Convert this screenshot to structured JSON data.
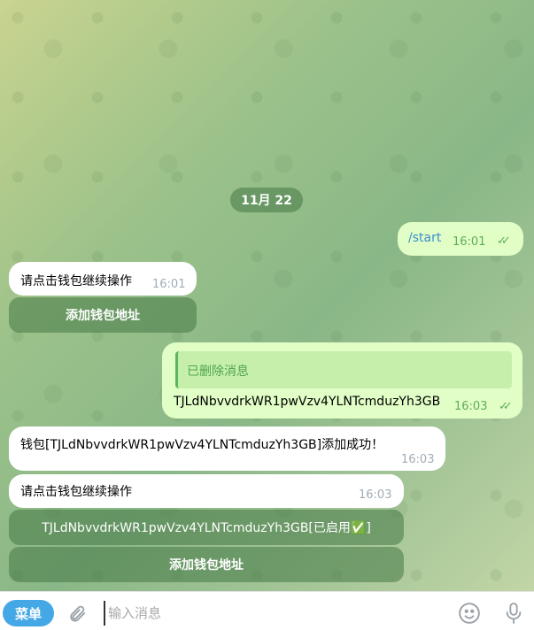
{
  "date_separator": "11月 22",
  "messages": {
    "start": {
      "text": "/start",
      "time": "16:01",
      "status": "✓✓"
    },
    "prompt1": {
      "text": "请点击钱包继续操作",
      "time": "16:01",
      "button": "添加钱包地址"
    },
    "wallet_out": {
      "quote_label": "已删除消息",
      "text": "TJLdNbvvdrkWR1pwVzv4YLNTcmduzYh3GB",
      "time": "16:03",
      "status": "✓✓"
    },
    "added": {
      "text": "钱包[TJLdNbvvdrkWR1pwVzv4YLNTcmduzYh3GB]添加成功！",
      "time": "16:03"
    },
    "prompt2": {
      "text": "请点击钱包继续操作",
      "time": "16:03",
      "wallet_button": "TJLdNbvvdrkWR1pwVzv4YLNTcmduzYh3GB[已启用✅]",
      "add_button": "添加钱包地址"
    }
  },
  "composer": {
    "menu_label": "菜单",
    "placeholder": "输入消息"
  },
  "colors": {
    "accent": "#45a8e6",
    "outgoing": "#e1fec6",
    "incoming": "#ffffff",
    "check": "#5faa5f"
  },
  "icons": [
    "paperclip-icon",
    "emoji-icon",
    "microphone-icon",
    "double-check-icon"
  ]
}
